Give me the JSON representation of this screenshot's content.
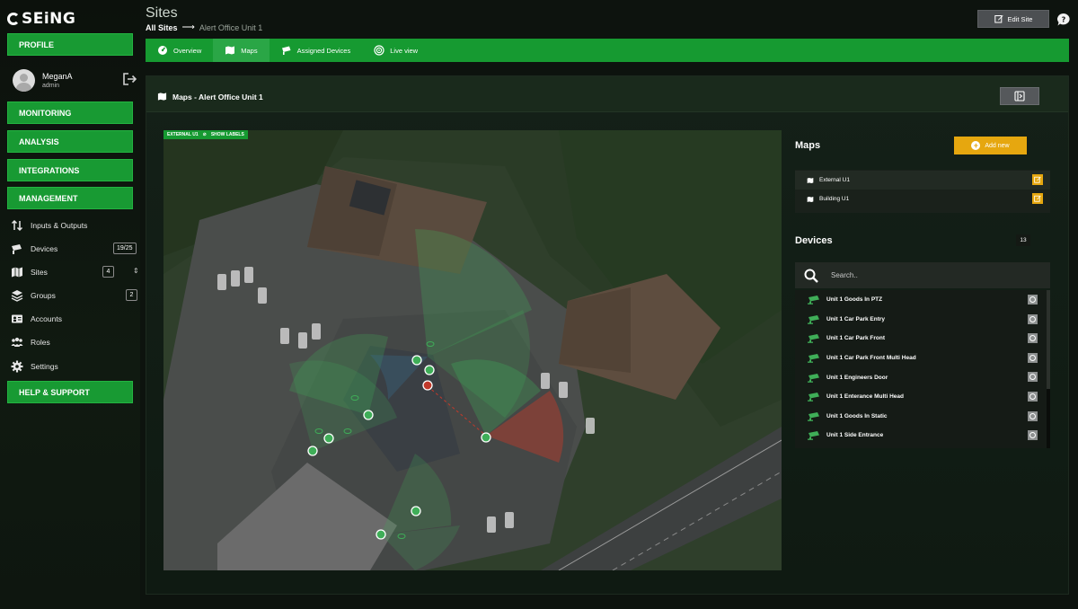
{
  "app": {
    "brand": "SEiNG"
  },
  "sidebar": {
    "profile_label": "PROFILE",
    "user": {
      "name": "MeganA",
      "role": "admin"
    },
    "sections": [
      "MONITORING",
      "ANALYSIS",
      "INTEGRATIONS",
      "MANAGEMENT"
    ],
    "items": [
      {
        "label": "Inputs & Outputs",
        "icon": "arrows-updown-icon",
        "badge": ""
      },
      {
        "label": "Devices",
        "icon": "camera-icon",
        "badge": "19/25"
      },
      {
        "label": "Sites",
        "icon": "map-icon",
        "badge": "4"
      },
      {
        "label": "Groups",
        "icon": "layers-icon",
        "badge": "2"
      },
      {
        "label": "Accounts",
        "icon": "id-card-icon",
        "badge": ""
      },
      {
        "label": "Roles",
        "icon": "users-icon",
        "badge": ""
      },
      {
        "label": "Settings",
        "icon": "gear-icon",
        "badge": ""
      }
    ],
    "help_label": "HELP & SUPPORT"
  },
  "header": {
    "title": "Sites",
    "breadcrumb_root": "All Sites",
    "breadcrumb_current": "Alert Office Unit 1",
    "edit_label": "Edit Site"
  },
  "tabs": [
    {
      "label": "Overview",
      "icon": "dashboard-icon",
      "active": false
    },
    {
      "label": "Maps",
      "icon": "map-icon",
      "active": true
    },
    {
      "label": "Assigned Devices",
      "icon": "camera-icon",
      "active": false
    },
    {
      "label": "Live view",
      "icon": "live-icon",
      "active": false
    }
  ],
  "panel": {
    "title": "Maps - Alert Office Unit 1"
  },
  "map": {
    "active_map": "EXTERNAL U1",
    "show_labels": "SHOW LABELS",
    "accent_color": "#169a31"
  },
  "maps_section": {
    "title": "Maps",
    "add_label": "Add new",
    "items": [
      "External U1",
      "Building U1"
    ]
  },
  "devices_section": {
    "title": "Devices",
    "count": "13",
    "search_placeholder": "Search..",
    "items": [
      "Unit 1 Goods In PTZ",
      "Unit 1 Car Park Entry",
      "Unit 1 Car Park Front",
      "Unit 1 Car Park Front Multi Head",
      "Unit 1 Engineers Door",
      "Unit 1 Enterance Multi Head",
      "Unit 1 Goods In Static",
      "Unit 1 Side Entrance"
    ]
  },
  "colors": {
    "primary_green": "#169a31",
    "warning_yellow": "#e6a70f",
    "alert_red": "#c0392b"
  }
}
